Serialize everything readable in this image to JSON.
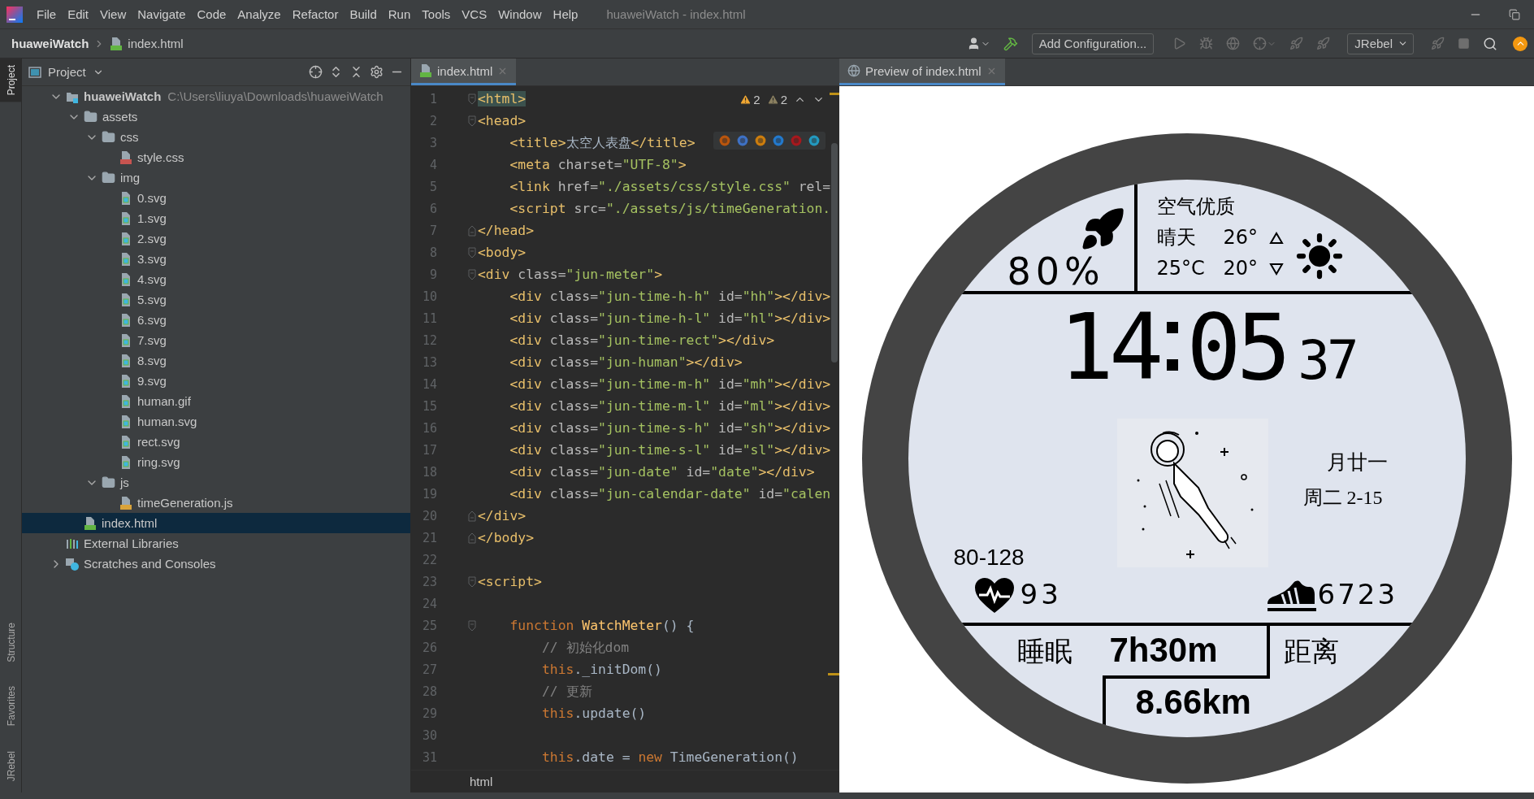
{
  "window": {
    "title": "huaweiWatch - index.html",
    "menu": [
      "File",
      "Edit",
      "View",
      "Navigate",
      "Code",
      "Analyze",
      "Refactor",
      "Build",
      "Run",
      "Tools",
      "VCS",
      "Window",
      "Help"
    ]
  },
  "navbar": {
    "project": "huaweiWatch",
    "file": "index.html",
    "run_config": "Add Configuration...",
    "plugin_menu": "JRebel"
  },
  "tool_strip": [
    {
      "label": "Project",
      "selected": true
    },
    {
      "label": "Structure",
      "selected": false
    },
    {
      "label": "Favorites",
      "selected": false
    },
    {
      "label": "JRebel",
      "selected": false
    }
  ],
  "project_panel": {
    "title": "Project",
    "tree": [
      {
        "name": "huaweiWatch",
        "path": "C:\\Users\\liuya\\Downloads\\huaweiWatch",
        "kind": "module",
        "expanded": true,
        "selected": false,
        "children": [
          {
            "name": "assets",
            "kind": "folder",
            "expanded": true,
            "selected": false,
            "children": [
              {
                "name": "css",
                "kind": "folder",
                "expanded": true,
                "selected": false,
                "children": [
                  {
                    "name": "style.css",
                    "kind": "css",
                    "selected": false
                  }
                ]
              },
              {
                "name": "img",
                "kind": "folder",
                "expanded": true,
                "selected": false,
                "children": [
                  {
                    "name": "0.svg",
                    "kind": "image",
                    "selected": false
                  },
                  {
                    "name": "1.svg",
                    "kind": "image",
                    "selected": false
                  },
                  {
                    "name": "2.svg",
                    "kind": "image",
                    "selected": false
                  },
                  {
                    "name": "3.svg",
                    "kind": "image",
                    "selected": false
                  },
                  {
                    "name": "4.svg",
                    "kind": "image",
                    "selected": false
                  },
                  {
                    "name": "5.svg",
                    "kind": "image",
                    "selected": false
                  },
                  {
                    "name": "6.svg",
                    "kind": "image",
                    "selected": false
                  },
                  {
                    "name": "7.svg",
                    "kind": "image",
                    "selected": false
                  },
                  {
                    "name": "8.svg",
                    "kind": "image",
                    "selected": false
                  },
                  {
                    "name": "9.svg",
                    "kind": "image",
                    "selected": false
                  },
                  {
                    "name": "human.gif",
                    "kind": "image",
                    "selected": false
                  },
                  {
                    "name": "human.svg",
                    "kind": "image",
                    "selected": false
                  },
                  {
                    "name": "rect.svg",
                    "kind": "image",
                    "selected": false
                  },
                  {
                    "name": "ring.svg",
                    "kind": "image",
                    "selected": false
                  }
                ]
              },
              {
                "name": "js",
                "kind": "folder",
                "expanded": true,
                "selected": false,
                "children": [
                  {
                    "name": "timeGeneration.js",
                    "kind": "js",
                    "selected": false
                  }
                ]
              }
            ]
          },
          {
            "name": "index.html",
            "kind": "html",
            "selected": true
          }
        ]
      },
      {
        "name": "External Libraries",
        "kind": "libraries",
        "selected": false
      },
      {
        "name": "Scratches and Consoles",
        "kind": "scratches",
        "expanded": false,
        "selected": false
      }
    ]
  },
  "editor": {
    "tabs": [
      {
        "label": "index.html",
        "selected": true
      }
    ],
    "inspections": [
      {
        "kind": "warning",
        "count": "2"
      },
      {
        "kind": "weak",
        "count": "2"
      }
    ],
    "lines": [
      {
        "number": "1",
        "kind": "fold-start",
        "tokens": [
          {
            "kind": "match",
            "text": "<html>"
          }
        ]
      },
      {
        "number": "2",
        "kind": "fold-start",
        "tokens": [
          {
            "kind": "tag",
            "text": "<head>"
          }
        ]
      },
      {
        "number": "3",
        "tokens": [
          {
            "kind": "tag",
            "text": "    <title>"
          },
          {
            "kind": "plain",
            "text": "太空人表盘"
          },
          {
            "kind": "tag",
            "text": "</title>"
          }
        ]
      },
      {
        "number": "4",
        "tokens": [
          {
            "kind": "tag",
            "text": "    <meta "
          },
          {
            "kind": "attr",
            "text": "charset="
          },
          {
            "kind": "str",
            "text": "\"UTF-8\""
          },
          {
            "kind": "tag",
            "text": ">"
          }
        ]
      },
      {
        "number": "5",
        "tokens": [
          {
            "kind": "tag",
            "text": "    <link "
          },
          {
            "kind": "attr",
            "text": "href="
          },
          {
            "kind": "str",
            "text": "\"./assets/css/style.css\""
          },
          {
            "kind": "attr",
            "text": " rel="
          }
        ]
      },
      {
        "number": "6",
        "tokens": [
          {
            "kind": "tag",
            "text": "    <script "
          },
          {
            "kind": "attr",
            "text": "src="
          },
          {
            "kind": "str",
            "text": "\"./assets/js/timeGeneration."
          }
        ]
      },
      {
        "number": "7",
        "kind": "fold-end",
        "tokens": [
          {
            "kind": "tag",
            "text": "</head>"
          }
        ]
      },
      {
        "number": "8",
        "kind": "fold-start",
        "tokens": [
          {
            "kind": "tag",
            "text": "<body>"
          }
        ]
      },
      {
        "number": "9",
        "kind": "fold-start",
        "tokens": [
          {
            "kind": "tag",
            "text": "<div "
          },
          {
            "kind": "attr",
            "text": "class="
          },
          {
            "kind": "str",
            "text": "\"jun-meter\""
          },
          {
            "kind": "tag",
            "text": ">"
          }
        ]
      },
      {
        "number": "10",
        "tokens": [
          {
            "kind": "tag",
            "text": "    <div "
          },
          {
            "kind": "attr",
            "text": "class="
          },
          {
            "kind": "str",
            "text": "\"jun-time-h-h\""
          },
          {
            "kind": "attr",
            "text": " id="
          },
          {
            "kind": "str",
            "text": "\"hh\""
          },
          {
            "kind": "tag",
            "text": "></div>"
          }
        ]
      },
      {
        "number": "11",
        "tokens": [
          {
            "kind": "tag",
            "text": "    <div "
          },
          {
            "kind": "attr",
            "text": "class="
          },
          {
            "kind": "str",
            "text": "\"jun-time-h-l\""
          },
          {
            "kind": "attr",
            "text": " id="
          },
          {
            "kind": "str",
            "text": "\"hl\""
          },
          {
            "kind": "tag",
            "text": "></div>"
          }
        ]
      },
      {
        "number": "12",
        "tokens": [
          {
            "kind": "tag",
            "text": "    <div "
          },
          {
            "kind": "attr",
            "text": "class="
          },
          {
            "kind": "str",
            "text": "\"jun-time-rect\""
          },
          {
            "kind": "tag",
            "text": "></div>"
          }
        ]
      },
      {
        "number": "13",
        "tokens": [
          {
            "kind": "tag",
            "text": "    <div "
          },
          {
            "kind": "attr",
            "text": "class="
          },
          {
            "kind": "str",
            "text": "\"jun-human\""
          },
          {
            "kind": "tag",
            "text": "></div>"
          }
        ]
      },
      {
        "number": "14",
        "tokens": [
          {
            "kind": "tag",
            "text": "    <div "
          },
          {
            "kind": "attr",
            "text": "class="
          },
          {
            "kind": "str",
            "text": "\"jun-time-m-h\""
          },
          {
            "kind": "attr",
            "text": " id="
          },
          {
            "kind": "str",
            "text": "\"mh\""
          },
          {
            "kind": "tag",
            "text": "></div>"
          }
        ]
      },
      {
        "number": "15",
        "tokens": [
          {
            "kind": "tag",
            "text": "    <div "
          },
          {
            "kind": "attr",
            "text": "class="
          },
          {
            "kind": "str",
            "text": "\"jun-time-m-l\""
          },
          {
            "kind": "attr",
            "text": " id="
          },
          {
            "kind": "str",
            "text": "\"ml\""
          },
          {
            "kind": "tag",
            "text": "></div>"
          }
        ]
      },
      {
        "number": "16",
        "tokens": [
          {
            "kind": "tag",
            "text": "    <div "
          },
          {
            "kind": "attr",
            "text": "class="
          },
          {
            "kind": "str",
            "text": "\"jun-time-s-h\""
          },
          {
            "kind": "attr",
            "text": " id="
          },
          {
            "kind": "str",
            "text": "\"sh\""
          },
          {
            "kind": "tag",
            "text": "></div>"
          }
        ]
      },
      {
        "number": "17",
        "tokens": [
          {
            "kind": "tag",
            "text": "    <div "
          },
          {
            "kind": "attr",
            "text": "class="
          },
          {
            "kind": "str",
            "text": "\"jun-time-s-l\""
          },
          {
            "kind": "attr",
            "text": " id="
          },
          {
            "kind": "str",
            "text": "\"sl\""
          },
          {
            "kind": "tag",
            "text": "></div>"
          }
        ]
      },
      {
        "number": "18",
        "tokens": [
          {
            "kind": "tag",
            "text": "    <div "
          },
          {
            "kind": "attr",
            "text": "class="
          },
          {
            "kind": "str",
            "text": "\"jun-date\""
          },
          {
            "kind": "attr",
            "text": " id="
          },
          {
            "kind": "str",
            "text": "\"date\""
          },
          {
            "kind": "tag",
            "text": "></div>"
          }
        ]
      },
      {
        "number": "19",
        "tokens": [
          {
            "kind": "tag",
            "text": "    <div "
          },
          {
            "kind": "attr",
            "text": "class="
          },
          {
            "kind": "str",
            "text": "\"jun-calendar-date\""
          },
          {
            "kind": "attr",
            "text": " id="
          },
          {
            "kind": "str",
            "text": "\"calen"
          }
        ]
      },
      {
        "number": "20",
        "kind": "fold-end",
        "tokens": [
          {
            "kind": "tag",
            "text": "</div>"
          }
        ]
      },
      {
        "number": "21",
        "kind": "fold-end",
        "tokens": [
          {
            "kind": "tag",
            "text": "</body>"
          }
        ]
      },
      {
        "number": "22"
      },
      {
        "number": "23",
        "kind": "fold-start",
        "tokens": [
          {
            "kind": "tag",
            "text": "<script>"
          }
        ]
      },
      {
        "number": "24"
      },
      {
        "number": "25",
        "kind": "fold-start",
        "tokens": [
          {
            "kind": "keyword",
            "text": "    function"
          },
          {
            "kind": "func",
            "text": " WatchMeter"
          },
          {
            "kind": "plain",
            "text": "() {"
          }
        ]
      },
      {
        "number": "26",
        "tokens": [
          {
            "kind": "comment",
            "text": "        // 初始化dom"
          }
        ]
      },
      {
        "number": "27",
        "tokens": [
          {
            "kind": "keyword",
            "text": "        this"
          },
          {
            "kind": "plain",
            "text": "._initDom()"
          }
        ]
      },
      {
        "number": "28",
        "tokens": [
          {
            "kind": "comment",
            "text": "        // 更新"
          }
        ]
      },
      {
        "number": "29",
        "tokens": [
          {
            "kind": "keyword",
            "text": "        this"
          },
          {
            "kind": "plain",
            "text": ".update()"
          }
        ]
      },
      {
        "number": "30"
      },
      {
        "number": "31",
        "tokens": [
          {
            "kind": "keyword",
            "text": "        this"
          },
          {
            "kind": "plain",
            "text": ".date = "
          },
          {
            "kind": "keyword",
            "text": "new"
          },
          {
            "kind": "plain",
            "text": " TimeGeneration()"
          }
        ]
      }
    ],
    "breadcrumb": "html"
  },
  "preview": {
    "tabs": [
      {
        "label": "Preview of index.html",
        "selected": true
      }
    ],
    "watch": {
      "battery": "80%",
      "air_quality": "空气优质",
      "weather": "晴天",
      "high": "26°",
      "current_temp": "25°C",
      "low": "20°",
      "hours": "14",
      "minutes": "05",
      "seconds": "37",
      "lunar_date": "月廿一",
      "weekday_date": "周二 2-15",
      "heart_range": "80-128",
      "heart_rate": "93",
      "steps": "6723",
      "sleep_label": "睡眠",
      "sleep": "7h30m",
      "distance_label": "距离",
      "distance": "8.66km"
    }
  }
}
